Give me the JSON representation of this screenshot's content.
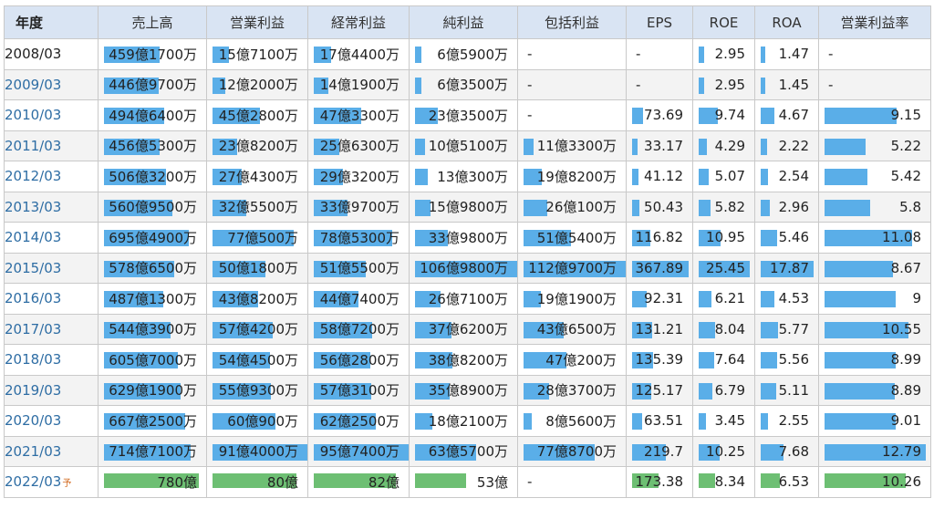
{
  "header": {
    "year": "年度",
    "sales": "売上高",
    "op": "営業利益",
    "ord": "経常利益",
    "net": "純利益",
    "comp": "包括利益",
    "eps": "EPS",
    "roe": "ROE",
    "roa": "ROA",
    "opm": "営業利益率"
  },
  "colors": {
    "bar_actual": "#5aaee8",
    "bar_forecast": "#6dbf73",
    "header_bg": "#d9e4f3",
    "link": "#2e6da4"
  },
  "rows": [
    {
      "year": "2008/03",
      "sales": "459億1700万",
      "op": "15億7100万",
      "ord": "17億4400万",
      "net": "6億5900万",
      "comp": "-",
      "eps": "-",
      "roe": "2.95",
      "roa": "1.47",
      "opm": "-"
    },
    {
      "year": "2009/03",
      "sales": "446億9700万",
      "op": "12億2000万",
      "ord": "14億1900万",
      "net": "6億3500万",
      "comp": "-",
      "eps": "-",
      "roe": "2.95",
      "roa": "1.45",
      "opm": "-"
    },
    {
      "year": "2010/03",
      "sales": "494億6400万",
      "op": "45億2800万",
      "ord": "47億3300万",
      "net": "23億3500万",
      "comp": "-",
      "eps": "73.69",
      "roe": "9.74",
      "roa": "4.67",
      "opm": "9.15"
    },
    {
      "year": "2011/03",
      "sales": "456億5300万",
      "op": "23億8200万",
      "ord": "25億6300万",
      "net": "10億5100万",
      "comp": "11億3300万",
      "eps": "33.17",
      "roe": "4.29",
      "roa": "2.22",
      "opm": "5.22"
    },
    {
      "year": "2012/03",
      "sales": "506億3200万",
      "op": "27億4300万",
      "ord": "29億3200万",
      "net": "13億300万",
      "comp": "19億8200万",
      "eps": "41.12",
      "roe": "5.07",
      "roa": "2.54",
      "opm": "5.42"
    },
    {
      "year": "2013/03",
      "sales": "560億9500万",
      "op": "32億5500万",
      "ord": "33億9700万",
      "net": "15億9800万",
      "comp": "26億100万",
      "eps": "50.43",
      "roe": "5.82",
      "roa": "2.96",
      "opm": "5.8"
    },
    {
      "year": "2014/03",
      "sales": "695億4900万",
      "op": "77億500万",
      "ord": "78億5300万",
      "net": "33億9800万",
      "comp": "51億5400万",
      "eps": "116.82",
      "roe": "10.95",
      "roa": "5.46",
      "opm": "11.08"
    },
    {
      "year": "2015/03",
      "sales": "578億6500万",
      "op": "50億1800万",
      "ord": "51億5500万",
      "net": "106億9800万",
      "comp": "112億9700万",
      "eps": "367.89",
      "roe": "25.45",
      "roa": "17.87",
      "opm": "8.67"
    },
    {
      "year": "2016/03",
      "sales": "487億1300万",
      "op": "43億8200万",
      "ord": "44億7400万",
      "net": "26億7100万",
      "comp": "19億1900万",
      "eps": "92.31",
      "roe": "6.21",
      "roa": "4.53",
      "opm": "9"
    },
    {
      "year": "2017/03",
      "sales": "544億3900万",
      "op": "57億4200万",
      "ord": "58億7200万",
      "net": "37億6200万",
      "comp": "43億6500万",
      "eps": "131.21",
      "roe": "8.04",
      "roa": "5.77",
      "opm": "10.55"
    },
    {
      "year": "2018/03",
      "sales": "605億7000万",
      "op": "54億4500万",
      "ord": "56億2800万",
      "net": "38億8200万",
      "comp": "47億200万",
      "eps": "135.39",
      "roe": "7.64",
      "roa": "5.56",
      "opm": "8.99"
    },
    {
      "year": "2019/03",
      "sales": "629億1900万",
      "op": "55億9300万",
      "ord": "57億3100万",
      "net": "35億8900万",
      "comp": "28億3700万",
      "eps": "125.17",
      "roe": "6.79",
      "roa": "5.11",
      "opm": "8.89"
    },
    {
      "year": "2020/03",
      "sales": "667億2500万",
      "op": "60億900万",
      "ord": "62億2500万",
      "net": "18億2100万",
      "comp": "8億5600万",
      "eps": "63.51",
      "roe": "3.45",
      "roa": "2.55",
      "opm": "9.01"
    },
    {
      "year": "2021/03",
      "sales": "714億7100万",
      "op": "91億4000万",
      "ord": "95億7400万",
      "net": "63億5700万",
      "comp": "77億8700万",
      "eps": "219.7",
      "roe": "10.25",
      "roa": "7.68",
      "opm": "12.79"
    },
    {
      "year": "2022/03",
      "yosou": "予",
      "sales": "780億",
      "op": "80億",
      "ord": "82億",
      "net": "53億",
      "comp": "-",
      "eps": "173.38",
      "roe": "8.34",
      "roa": "6.53",
      "opm": "10.26"
    }
  ]
}
